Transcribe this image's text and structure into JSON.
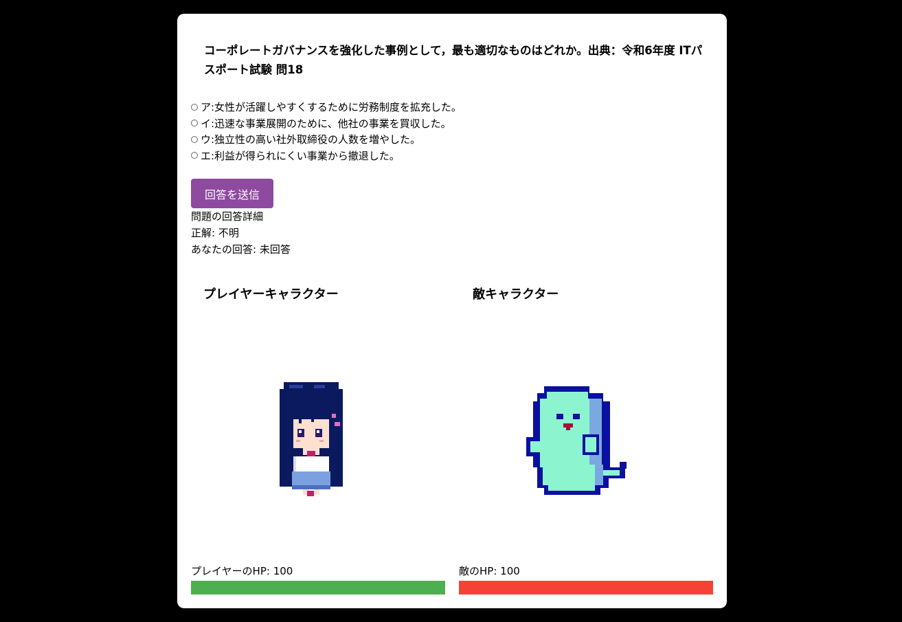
{
  "question": {
    "text": "コーポレートガバナンスを強化した事例として，最も適切なものはどれか。出典：令和6年度 ITパスポート試験 問18"
  },
  "options": [
    {
      "label": "ア:女性が活躍しやすくするために労務制度を拡充した。"
    },
    {
      "label": "イ:迅速な事業展開のために、他社の事業を買収した。"
    },
    {
      "label": "ウ:独立性の高い社外取締役の人数を増やした。"
    },
    {
      "label": "エ:利益が得られにくい事業から撤退した。"
    }
  ],
  "submit_label": "回答を送信",
  "details": {
    "title": "問題の回答詳細",
    "correct": "正解: 不明",
    "your_answer": "あなたの回答: 未回答"
  },
  "player": {
    "title": "プレイヤーキャラクター",
    "hp_label": "プレイヤーのHP: 100",
    "hp_fraction": 1.0,
    "hp_color": "#4caf50",
    "sprite": "pixel-girl-icon"
  },
  "enemy": {
    "title": "敵キャラクター",
    "hp_label": "敵のHP: 100",
    "hp_fraction": 1.0,
    "hp_color": "#f44336",
    "sprite": "pixel-ghost-icon"
  }
}
